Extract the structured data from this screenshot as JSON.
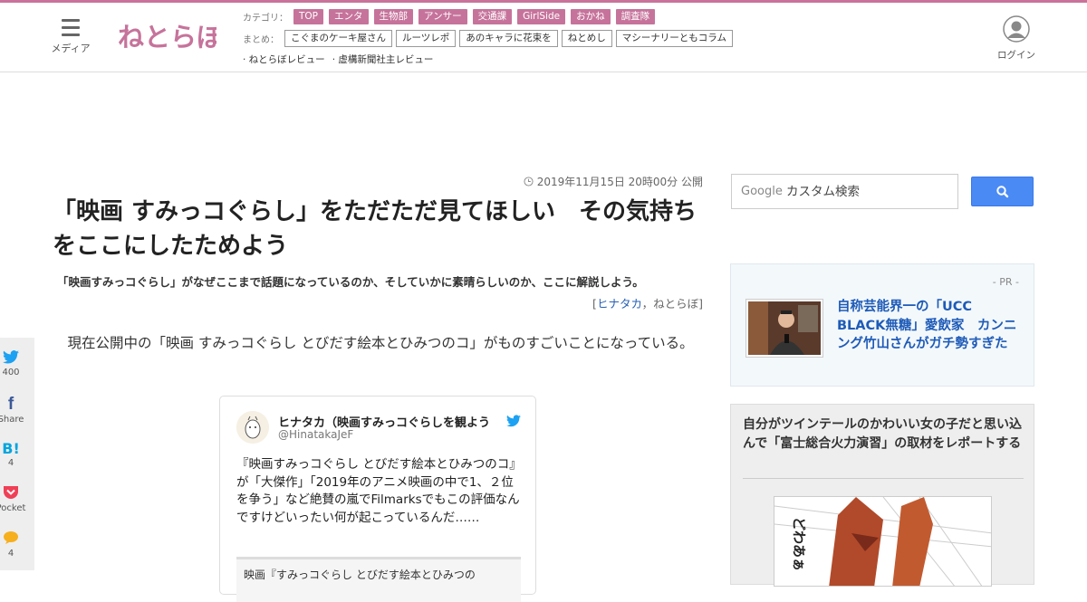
{
  "header": {
    "menu_label": "メディア",
    "logo_text": "ねとらぼ",
    "category_label": "カテゴリ：",
    "categories": [
      "TOP",
      "エンタ",
      "生物部",
      "アンサー",
      "交通課",
      "GirlSide",
      "おかね",
      "調査隊"
    ],
    "summary_label": "まとめ：",
    "summaries": [
      "こぐまのケーキ屋さん",
      "ルーツレポ",
      "あのキャラに花束を",
      "ねとめし",
      "マシーナリーともコラム"
    ],
    "links": [
      "· ねとらぼレビュー",
      "· 虚構新聞社主レビュー"
    ],
    "login_label": "ログイン"
  },
  "article": {
    "date": "2019年11月15日 20時00分 公開",
    "title": "「映画 すみっコぐらし」をただただ見てほしい　その気持ちをここにしたためよう",
    "subtitle": "「映画すみっコぐらし」がなぜここまで話題になっているのか、そしていかに素晴らしいのか、ここに解説しよう。",
    "byline_open": "[",
    "author": "ヒナタカ",
    "byline_sep": "，",
    "publisher": "ねとらぼ",
    "byline_close": "]",
    "body": "現在公開中の「映画 すみっコぐらし とびだす絵本とひみつのコ」がものすごいことになっている。"
  },
  "tweet": {
    "name": "ヒナタカ（映画すみっコぐらしを観よう",
    "handle": "@HinatakaJeF",
    "text": "『映画すみっコぐらし とびだす絵本とひみつのコ』が「大傑作」「2019年のアニメ映画の中で1、２位を争う」など絶賛の嵐でFilmarksでもこの評価なんですけどいったい何が起こっているんだ……",
    "card_text": "映画『すみっコぐらし とびだす絵本とひみつの"
  },
  "share": {
    "twitter_count": "400",
    "facebook_label": "Share",
    "hatena_label": "B!",
    "hatena_count": "4",
    "pocket_label": "Pocket",
    "comment_count": "4"
  },
  "sidebar": {
    "search_brand": "Google",
    "search_placeholder": "カスタム検索",
    "pr_label": "- PR -",
    "pr_title": "自称芸能界一の「UCC BLACK無糖」愛飲家　カンニング竹山さんがガチ勢すぎた",
    "feature_title": "自分がツインテールのかわいい女の子だと思い込んで「富士総合火力演習」の取材をレポートする"
  },
  "colors": {
    "accent": "#c6739b",
    "link": "#1e5bb8",
    "search_button": "#4a8af4",
    "twitter": "#1da1f2",
    "facebook": "#3b5998",
    "hatena": "#00a4de",
    "pocket": "#ef4056",
    "comment": "#f6b01e"
  },
  "icons": [
    "hamburger-icon",
    "user-icon",
    "clock-icon",
    "twitter-bird-icon",
    "facebook-icon",
    "hatena-icon",
    "pocket-icon",
    "comment-icon",
    "search-icon"
  ]
}
